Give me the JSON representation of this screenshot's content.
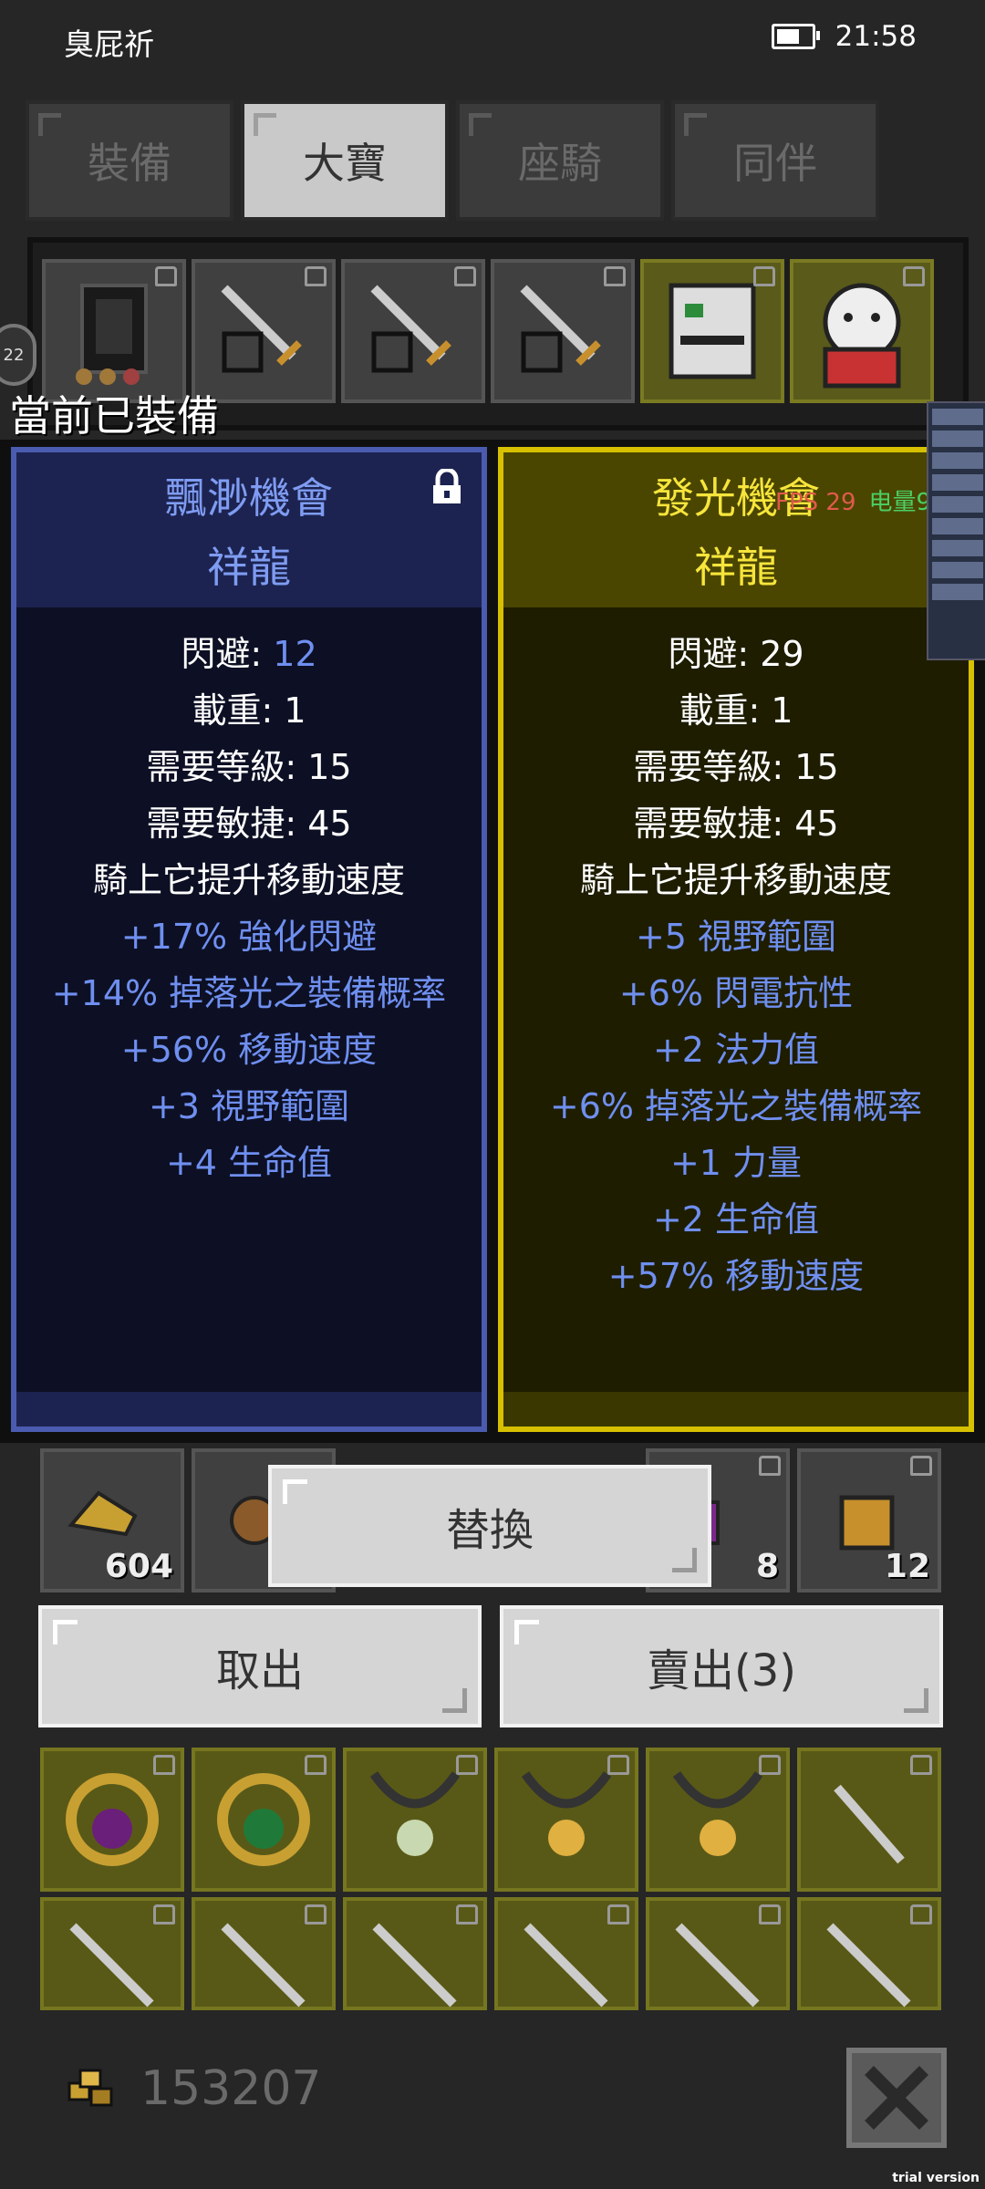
{
  "status": {
    "carrier": "臭屁祈",
    "time": "21:58"
  },
  "tabs": [
    {
      "label": "裝備",
      "active": false
    },
    {
      "label": "大寶",
      "active": true
    },
    {
      "label": "座騎",
      "active": false
    },
    {
      "label": "同伴",
      "active": false
    }
  ],
  "avatar_badge": "22",
  "equipped_label": "當前已裝備",
  "left_card": {
    "name": "飄渺機會",
    "type": "祥龍",
    "dodge_label": "閃避: ",
    "dodge_value": "12",
    "stats": [
      "載重: 1",
      "需要等級: 15",
      "需要敏捷: 45",
      "騎上它提升移動速度"
    ],
    "mods": [
      "+17% 強化閃避",
      "+14% 掉落光之裝備概率",
      "+56% 移動速度",
      "+3 視野範圍",
      "+4 生命值"
    ]
  },
  "right_card": {
    "name": "發光機會",
    "type": "祥龍",
    "dodge": "閃避: 29",
    "stats": [
      "載重: 1",
      "需要等級: 15",
      "需要敏捷: 45",
      "騎上它提升移動速度"
    ],
    "mods": [
      "+5 視野範圍",
      "+6% 閃電抗性",
      "+2 法力值",
      "+6% 掉落光之裝備概率",
      "+1 力量",
      "+2 生命值",
      "+57% 移動速度"
    ]
  },
  "overlay": {
    "fps": "FPS 29",
    "battery": "电量9"
  },
  "slot_counts": [
    "604",
    "8",
    "12"
  ],
  "buttons": {
    "replace": "替換",
    "take_out": "取出",
    "sell": "賣出(3)"
  },
  "gold": "153207",
  "trial": "trial version"
}
